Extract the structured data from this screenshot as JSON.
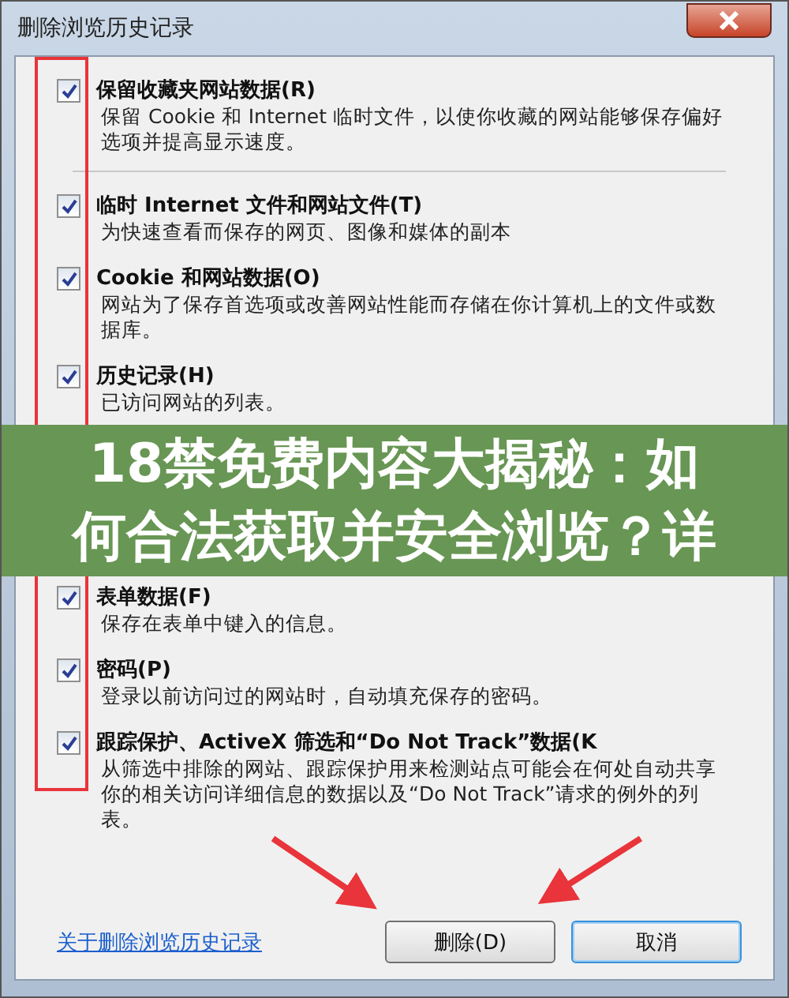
{
  "window": {
    "title": "删除浏览历史记录"
  },
  "options": [
    {
      "label": "保留收藏夹网站数据(R)",
      "description": "保留 Cookie 和 Internet 临时文件，以使你收藏的网站能够保存偏好选项并提高显示速度。",
      "checked": true,
      "divider_after": true
    },
    {
      "label": "临时 Internet 文件和网站文件(T)",
      "description": "为快速查看而保存的网页、图像和媒体的副本",
      "checked": true,
      "divider_after": false
    },
    {
      "label": "Cookie 和网站数据(O)",
      "description": "网站为了保存首选项或改善网站性能而存储在你计算机上的文件或数据库。",
      "checked": true,
      "divider_after": false
    },
    {
      "label": "历史记录(H)",
      "description": "已访问网站的列表。",
      "checked": true,
      "divider_after": false
    },
    {
      "label": "表单数据(F)",
      "description": "保存在表单中键入的信息。",
      "checked": true,
      "divider_after": false
    },
    {
      "label": "密码(P)",
      "description": "登录以前访问过的网站时，自动填充保存的密码。",
      "checked": true,
      "divider_after": false
    },
    {
      "label": "跟踪保护、ActiveX 筛选和“Do Not Track”数据(K",
      "description": "从筛选中排除的网站、跟踪保护用来检测站点可能会在何处自动共享你的相关访问详细信息的数据以及“Do Not Track”请求的例外的列表。",
      "checked": true,
      "divider_after": false
    }
  ],
  "link": "关于删除浏览历史记录",
  "buttons": [
    {
      "label": "删除(D)",
      "focused": false
    },
    {
      "label": "取消",
      "focused": true
    }
  ],
  "banner": {
    "text": "18禁免费内容大揭秘：如何合法获取并安全浏览？详"
  }
}
